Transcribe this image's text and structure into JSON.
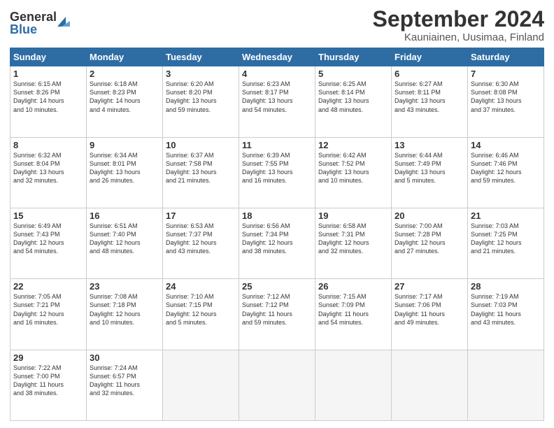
{
  "header": {
    "logo_line1": "General",
    "logo_line2": "Blue",
    "title": "September 2024",
    "subtitle": "Kauniainen, Uusimaa, Finland"
  },
  "weekdays": [
    "Sunday",
    "Monday",
    "Tuesday",
    "Wednesday",
    "Thursday",
    "Friday",
    "Saturday"
  ],
  "weeks": [
    [
      {
        "day": "1",
        "detail": "Sunrise: 6:15 AM\nSunset: 8:26 PM\nDaylight: 14 hours\nand 10 minutes."
      },
      {
        "day": "2",
        "detail": "Sunrise: 6:18 AM\nSunset: 8:23 PM\nDaylight: 14 hours\nand 4 minutes."
      },
      {
        "day": "3",
        "detail": "Sunrise: 6:20 AM\nSunset: 8:20 PM\nDaylight: 13 hours\nand 59 minutes."
      },
      {
        "day": "4",
        "detail": "Sunrise: 6:23 AM\nSunset: 8:17 PM\nDaylight: 13 hours\nand 54 minutes."
      },
      {
        "day": "5",
        "detail": "Sunrise: 6:25 AM\nSunset: 8:14 PM\nDaylight: 13 hours\nand 48 minutes."
      },
      {
        "day": "6",
        "detail": "Sunrise: 6:27 AM\nSunset: 8:11 PM\nDaylight: 13 hours\nand 43 minutes."
      },
      {
        "day": "7",
        "detail": "Sunrise: 6:30 AM\nSunset: 8:08 PM\nDaylight: 13 hours\nand 37 minutes."
      }
    ],
    [
      {
        "day": "8",
        "detail": "Sunrise: 6:32 AM\nSunset: 8:04 PM\nDaylight: 13 hours\nand 32 minutes."
      },
      {
        "day": "9",
        "detail": "Sunrise: 6:34 AM\nSunset: 8:01 PM\nDaylight: 13 hours\nand 26 minutes."
      },
      {
        "day": "10",
        "detail": "Sunrise: 6:37 AM\nSunset: 7:58 PM\nDaylight: 13 hours\nand 21 minutes."
      },
      {
        "day": "11",
        "detail": "Sunrise: 6:39 AM\nSunset: 7:55 PM\nDaylight: 13 hours\nand 16 minutes."
      },
      {
        "day": "12",
        "detail": "Sunrise: 6:42 AM\nSunset: 7:52 PM\nDaylight: 13 hours\nand 10 minutes."
      },
      {
        "day": "13",
        "detail": "Sunrise: 6:44 AM\nSunset: 7:49 PM\nDaylight: 13 hours\nand 5 minutes."
      },
      {
        "day": "14",
        "detail": "Sunrise: 6:46 AM\nSunset: 7:46 PM\nDaylight: 12 hours\nand 59 minutes."
      }
    ],
    [
      {
        "day": "15",
        "detail": "Sunrise: 6:49 AM\nSunset: 7:43 PM\nDaylight: 12 hours\nand 54 minutes."
      },
      {
        "day": "16",
        "detail": "Sunrise: 6:51 AM\nSunset: 7:40 PM\nDaylight: 12 hours\nand 48 minutes."
      },
      {
        "day": "17",
        "detail": "Sunrise: 6:53 AM\nSunset: 7:37 PM\nDaylight: 12 hours\nand 43 minutes."
      },
      {
        "day": "18",
        "detail": "Sunrise: 6:56 AM\nSunset: 7:34 PM\nDaylight: 12 hours\nand 38 minutes."
      },
      {
        "day": "19",
        "detail": "Sunrise: 6:58 AM\nSunset: 7:31 PM\nDaylight: 12 hours\nand 32 minutes."
      },
      {
        "day": "20",
        "detail": "Sunrise: 7:00 AM\nSunset: 7:28 PM\nDaylight: 12 hours\nand 27 minutes."
      },
      {
        "day": "21",
        "detail": "Sunrise: 7:03 AM\nSunset: 7:25 PM\nDaylight: 12 hours\nand 21 minutes."
      }
    ],
    [
      {
        "day": "22",
        "detail": "Sunrise: 7:05 AM\nSunset: 7:21 PM\nDaylight: 12 hours\nand 16 minutes."
      },
      {
        "day": "23",
        "detail": "Sunrise: 7:08 AM\nSunset: 7:18 PM\nDaylight: 12 hours\nand 10 minutes."
      },
      {
        "day": "24",
        "detail": "Sunrise: 7:10 AM\nSunset: 7:15 PM\nDaylight: 12 hours\nand 5 minutes."
      },
      {
        "day": "25",
        "detail": "Sunrise: 7:12 AM\nSunset: 7:12 PM\nDaylight: 11 hours\nand 59 minutes."
      },
      {
        "day": "26",
        "detail": "Sunrise: 7:15 AM\nSunset: 7:09 PM\nDaylight: 11 hours\nand 54 minutes."
      },
      {
        "day": "27",
        "detail": "Sunrise: 7:17 AM\nSunset: 7:06 PM\nDaylight: 11 hours\nand 49 minutes."
      },
      {
        "day": "28",
        "detail": "Sunrise: 7:19 AM\nSunset: 7:03 PM\nDaylight: 11 hours\nand 43 minutes."
      }
    ],
    [
      {
        "day": "29",
        "detail": "Sunrise: 7:22 AM\nSunset: 7:00 PM\nDaylight: 11 hours\nand 38 minutes."
      },
      {
        "day": "30",
        "detail": "Sunrise: 7:24 AM\nSunset: 6:57 PM\nDaylight: 11 hours\nand 32 minutes."
      },
      {
        "day": "",
        "detail": ""
      },
      {
        "day": "",
        "detail": ""
      },
      {
        "day": "",
        "detail": ""
      },
      {
        "day": "",
        "detail": ""
      },
      {
        "day": "",
        "detail": ""
      }
    ]
  ]
}
